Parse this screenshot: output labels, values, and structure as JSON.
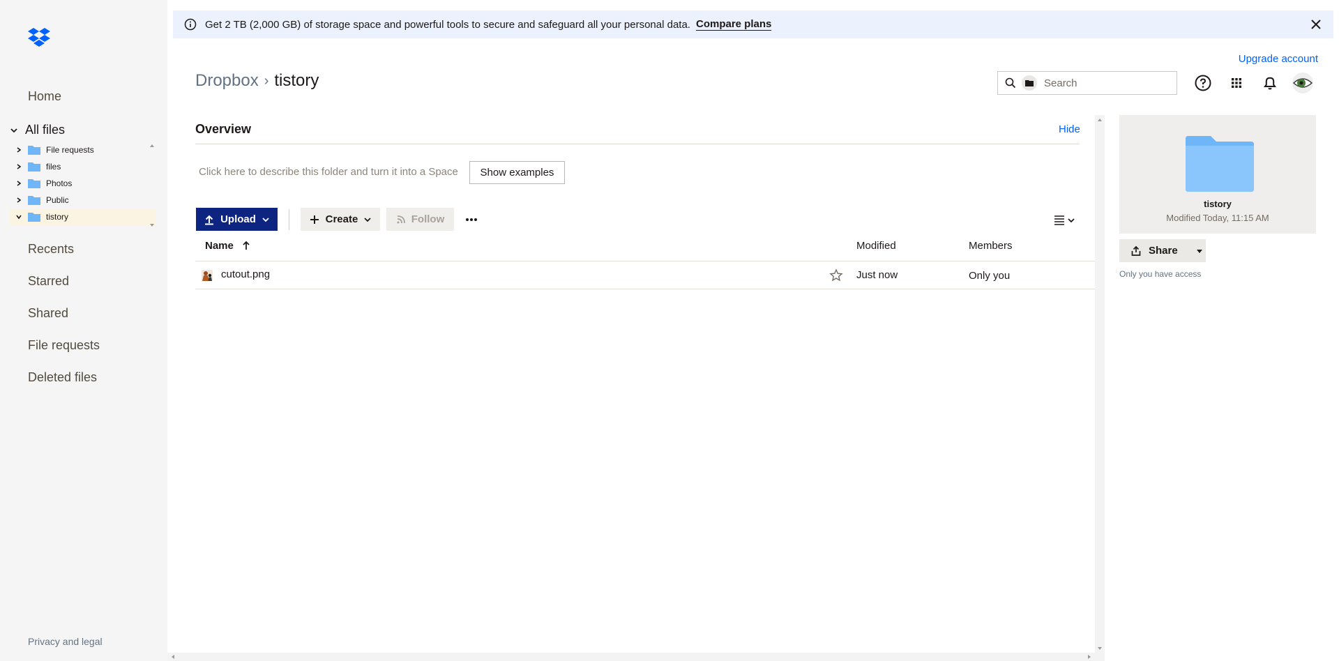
{
  "banner": {
    "text": "Get 2 TB (2,000 GB) of storage space and powerful tools to secure and safeguard all your personal data.",
    "link": "Compare plans"
  },
  "sidebar": {
    "home": "Home",
    "all_files": "All files",
    "tree": [
      "File requests",
      "files",
      "Photos",
      "Public",
      "tistory"
    ],
    "items": [
      "Recents",
      "Starred",
      "Shared",
      "File requests",
      "Deleted files"
    ],
    "privacy": "Privacy and legal"
  },
  "header": {
    "upgrade": "Upgrade account",
    "breadcrumb_root": "Dropbox",
    "breadcrumb_sep": "›",
    "breadcrumb_current": "tistory",
    "search_placeholder": "Search"
  },
  "overview": {
    "title": "Overview",
    "hide": "Hide",
    "describe": "Click here to describe this folder and turn it into a Space",
    "show_examples": "Show examples"
  },
  "toolbar": {
    "upload": "Upload",
    "create": "Create",
    "follow": "Follow"
  },
  "table": {
    "columns": {
      "name": "Name",
      "modified": "Modified",
      "members": "Members"
    },
    "rows": [
      {
        "name": "cutout.png",
        "modified": "Just now",
        "members": "Only you"
      }
    ]
  },
  "preview": {
    "name": "tistory",
    "modified": "Modified Today, 11:15 AM",
    "share": "Share",
    "access": "Only you have access"
  },
  "colors": {
    "accent": "#0061fe",
    "upload_bg": "#0d2481",
    "folder": "#6fb6f8",
    "sidebar_bg": "#f5f5f5"
  }
}
